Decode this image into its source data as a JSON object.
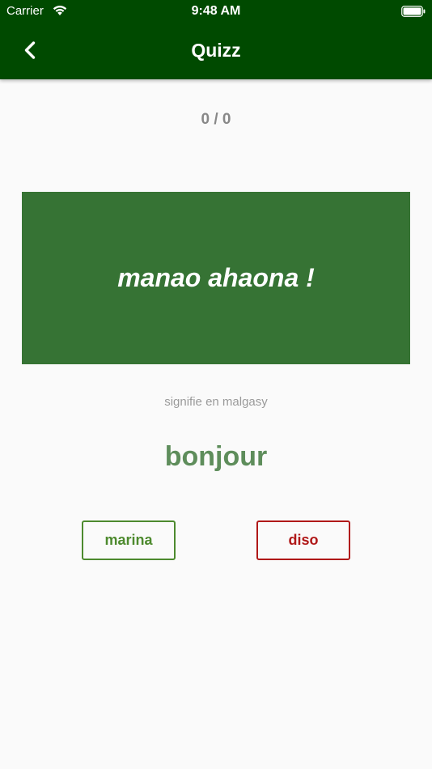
{
  "status_bar": {
    "carrier": "Carrier",
    "time": "9:48 AM",
    "icons": [
      "wifi-icon",
      "battery-icon"
    ]
  },
  "header": {
    "title": "Quizz",
    "back_icon": "chevron-left-icon"
  },
  "quiz": {
    "score": "0 / 0",
    "phrase": "manao ahaona !",
    "hint": "signifie en malgasy",
    "translation": "bonjour",
    "answer_yes": "marina",
    "answer_no": "diso"
  },
  "colors": {
    "appbar": "#004a00",
    "card": "#367334",
    "translation": "#5e8d5b",
    "yes": "#4d8a2e",
    "no": "#b01818",
    "background": "#fafafa"
  }
}
